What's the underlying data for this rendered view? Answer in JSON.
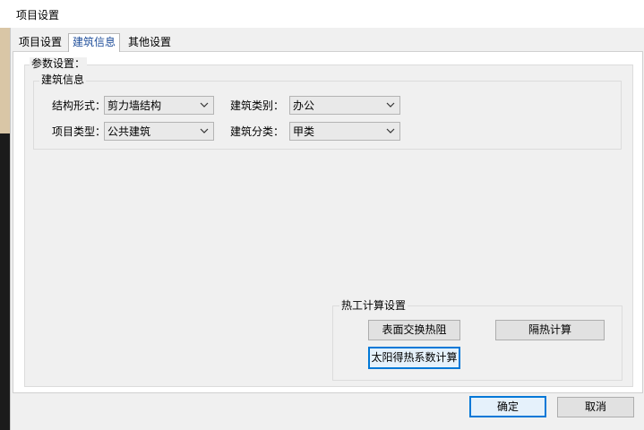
{
  "window": {
    "title": "项目设置"
  },
  "tabs": [
    {
      "label": "项目设置",
      "active": false
    },
    {
      "label": "建筑信息",
      "active": true
    },
    {
      "label": "其他设置",
      "active": false
    }
  ],
  "params_group": {
    "caption": "参数设置："
  },
  "building_info": {
    "caption": "建筑信息",
    "structure_form": {
      "label": "结构形式：",
      "value": "剪力墙结构"
    },
    "project_type": {
      "label": "项目类型：",
      "value": "公共建筑"
    },
    "building_category": {
      "label": "建筑类别：",
      "value": "办公"
    },
    "building_class": {
      "label": "建筑分类：",
      "value": "甲类"
    }
  },
  "thermal_settings": {
    "caption": "热工计算设置",
    "surface_resistance_label": "表面交换热阻",
    "insulation_calc_label": "隔热计算",
    "solar_gain_label": "太阳得热系数计算"
  },
  "footer": {
    "ok_label": "确定",
    "cancel_label": "取消"
  },
  "icons": {
    "combo_arrow": "chevron-down-icon"
  },
  "colors": {
    "focus_border": "#0078d7",
    "active_tab_text": "#1f4e9a"
  }
}
